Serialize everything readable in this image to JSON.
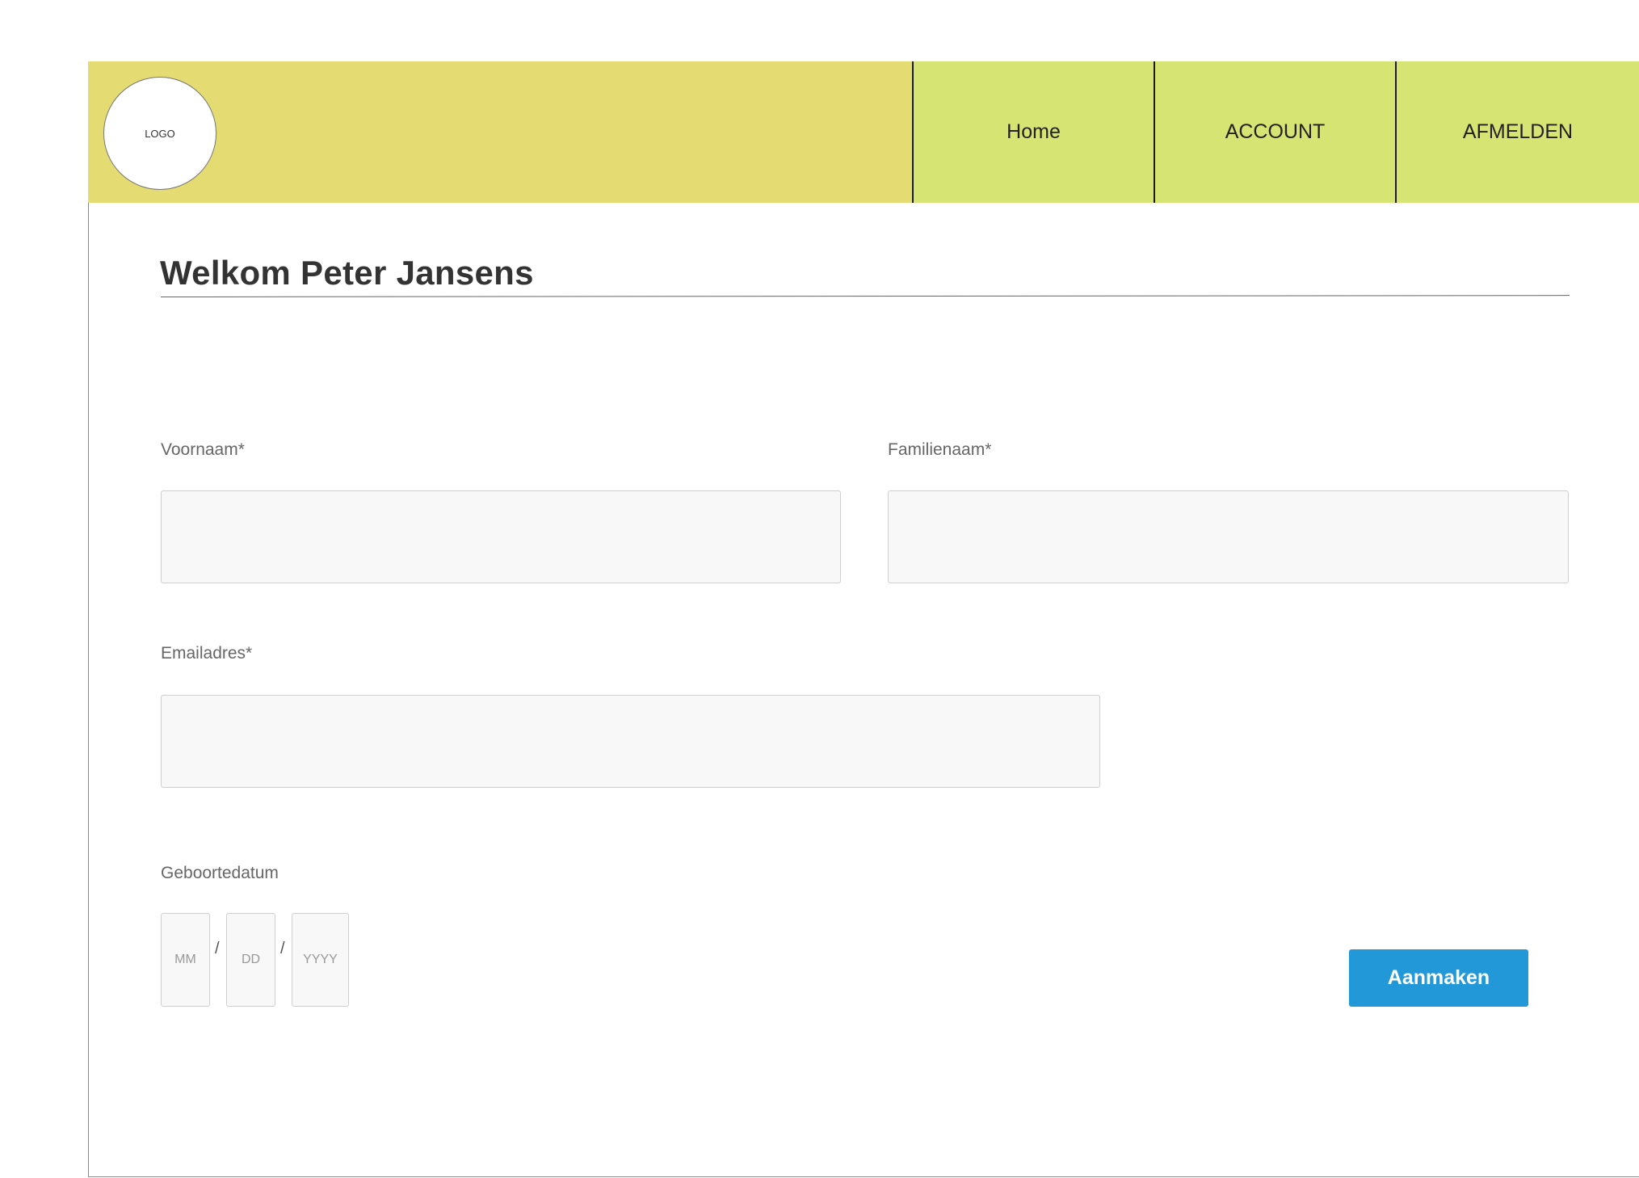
{
  "header": {
    "logo_text": "LOGO",
    "nav": [
      {
        "label": "Home"
      },
      {
        "label": "ACCOUNT"
      },
      {
        "label": "AFMELDEN"
      }
    ]
  },
  "page": {
    "title": "Welkom Peter Jansens"
  },
  "form": {
    "first_name": {
      "label": "Voornaam*",
      "value": ""
    },
    "last_name": {
      "label": "Familienaam*",
      "value": ""
    },
    "email": {
      "label": "Emailadres*",
      "value": ""
    },
    "birthdate": {
      "label": "Geboortedatum",
      "month_placeholder": "MM",
      "day_placeholder": "DD",
      "year_placeholder": "YYYY",
      "separator": "/"
    },
    "submit_label": "Aanmaken"
  },
  "colors": {
    "header_left": "#e4db72",
    "nav_bg": "#d6e474",
    "button": "#2398d9"
  }
}
